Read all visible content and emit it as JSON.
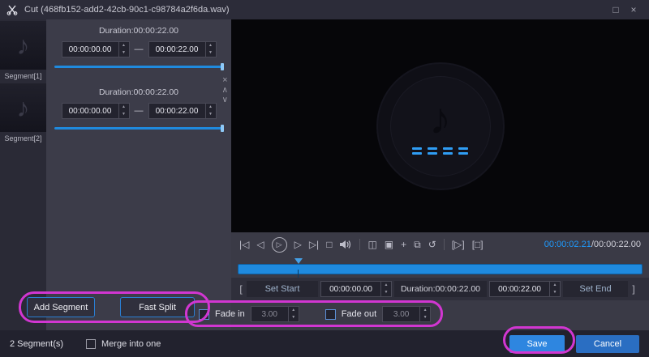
{
  "colors": {
    "accent": "#1f8ade",
    "time_blue": "#1e9bff",
    "annotation": "#d136d1"
  },
  "icons": {
    "scissors": "scissors-icon",
    "maximize": "□",
    "close": "×",
    "music_note": "♪",
    "spinner_up": "▲",
    "spinner_down": "▼",
    "segment_close": "×",
    "move_up": "∧",
    "move_down": "∨",
    "skip_start": "|◁",
    "step_back": "◁",
    "play": "▷",
    "step_forward": "▷",
    "skip_end": "▷|",
    "stop": "□",
    "split": "◫",
    "crop": "▣",
    "add": "+",
    "copy": "⧉",
    "reset": "↺",
    "play_clip": "[▷]",
    "stop_clip": "[□]"
  },
  "titlebar": {
    "title": "Cut (468fb152-add2-42cb-90c1-c98784a2f6da.wav)"
  },
  "segment_list": {
    "items": [
      {
        "label": "Segment[1]"
      },
      {
        "label": "Segment[2]"
      }
    ]
  },
  "segments": [
    {
      "duration": "Duration:00:00:22.00",
      "start": "00:00:00.00",
      "dash": "—",
      "end": "00:00:22.00"
    },
    {
      "duration": "Duration:00:00:22.00",
      "start": "00:00:00.00",
      "dash": "—",
      "end": "00:00:22.00"
    }
  ],
  "panel_buttons": {
    "add_segment": "Add Segment",
    "fast_split": "Fast Split"
  },
  "player": {
    "time_position": "00:00:02.21",
    "time_total": "/00:00:22.00",
    "bracket_left": "[",
    "bracket_right": "]",
    "set_start": "Set Start",
    "start_value": "00:00:00.00",
    "duration_label": "Duration:00:00:22.00",
    "end_value": "00:00:22.00",
    "set_end": "Set End",
    "fade_in": {
      "label": "Fade in",
      "value": "3.00"
    },
    "fade_out": {
      "label": "Fade out",
      "value": "3.00"
    }
  },
  "footer": {
    "segment_count": "2 Segment(s)",
    "merge_label": "Merge into one",
    "save": "Save",
    "cancel": "Cancel"
  }
}
